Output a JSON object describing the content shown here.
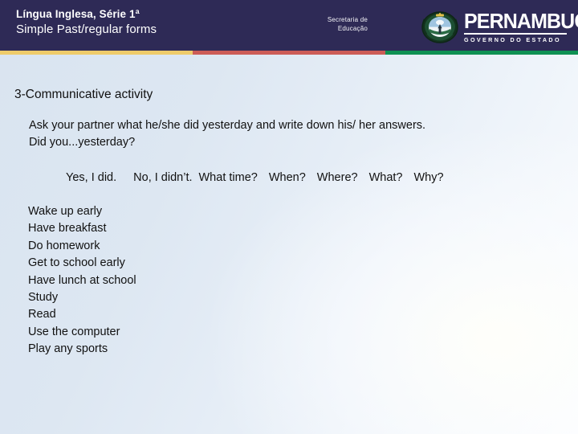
{
  "header": {
    "title_line1": "Língua Inglesa, Série 1ª",
    "title_line2": "Simple Past/regular forms",
    "secretaria_line1": "Secretaria de",
    "secretaria_line2": "Educação",
    "state_name": "PERNAMBUCO",
    "state_subtitle": "GOVERNO DO ESTADO",
    "background_color": "#2e2a56",
    "text_color": "#ffffff"
  },
  "stripe": {
    "segments": [
      {
        "name": "yellow",
        "color": "#eecb6a"
      },
      {
        "name": "red",
        "color": "#cc5c57"
      },
      {
        "name": "green",
        "color": "#0f9153"
      }
    ]
  },
  "main": {
    "section_heading": "3-Communicative activity",
    "instruction_line1": "Ask your partner what he/she did yesterday and write down his/ her answers.",
    "instruction_line2": "Did you...yesterday?",
    "answers": [
      "Yes, I did.",
      "No, I didn’t."
    ],
    "question_words": [
      "What time?",
      "When?",
      "Where?",
      "What?",
      "Why?"
    ],
    "activities": [
      "Wake up early",
      "Have breakfast",
      "Do homework",
      "Get to school early",
      "Have lunch at school",
      "Study",
      "Read",
      "Use the computer",
      "Play any sports"
    ]
  }
}
